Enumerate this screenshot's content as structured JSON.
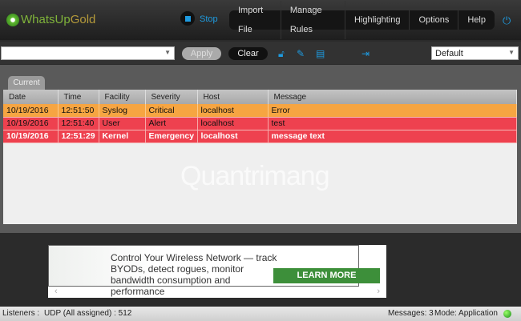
{
  "header": {
    "logo_left": "WhatsUp",
    "logo_right": "Gold",
    "stop_label": "Stop",
    "menu": [
      "Import File",
      "Manage Rules",
      "Highlighting",
      "Options",
      "Help"
    ]
  },
  "toolbar": {
    "filter_value": "",
    "apply_label": "Apply",
    "clear_label": "Clear",
    "view_select": "Default"
  },
  "tabs": [
    "Current"
  ],
  "table": {
    "columns": [
      "Date",
      "Time",
      "Facility",
      "Severity",
      "Host",
      "Message"
    ],
    "rows": [
      [
        "10/19/2016",
        "12:51:50",
        "Syslog",
        "Critical",
        "localhost",
        "Error"
      ],
      [
        "10/19/2016",
        "12:51:40",
        "User",
        "Alert",
        "localhost",
        "test"
      ],
      [
        "10/19/2016",
        "12:51:29",
        "Kernel",
        "Emergency",
        "localhost",
        "message text"
      ]
    ]
  },
  "watermark": "Quantrimang",
  "ad": {
    "text": "Control Your Wireless Network — track BYODs, detect rogues, monitor bandwidth consumption and performance",
    "button": "LEARN MORE"
  },
  "status": {
    "listeners_label": "Listeners :",
    "listeners_value": "UDP  (All assigned) : 512",
    "messages": "Messages: 3",
    "mode": "Mode: Application"
  },
  "colors": {
    "accent": "#1e9be0",
    "critical": "#f6a542",
    "alert": "#ee414f"
  }
}
